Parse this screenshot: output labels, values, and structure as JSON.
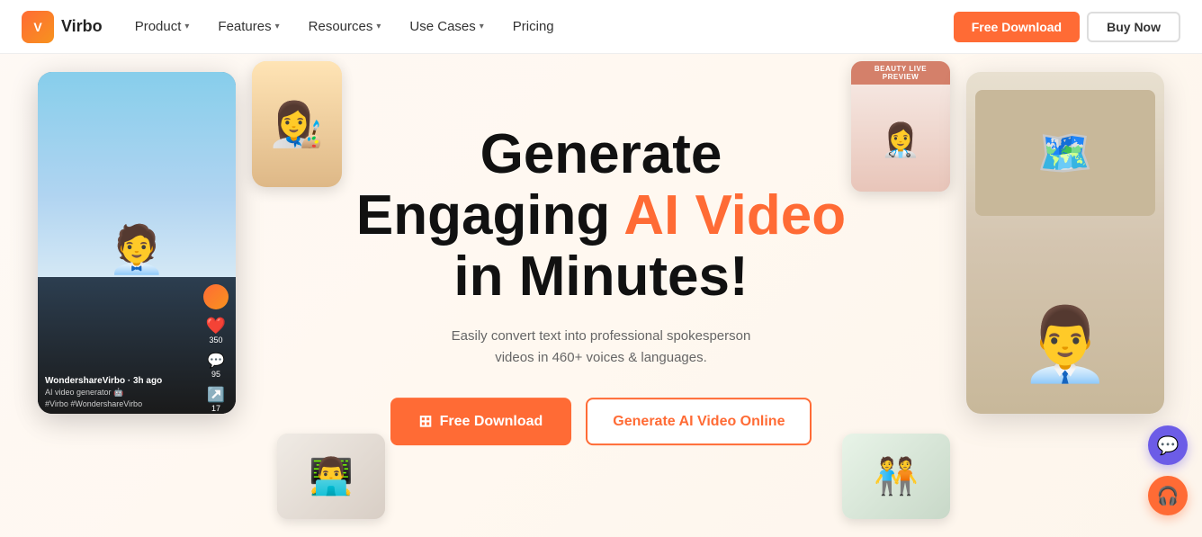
{
  "nav": {
    "logo_text": "Virbo",
    "items": [
      {
        "label": "Product",
        "has_dropdown": true
      },
      {
        "label": "Features",
        "has_dropdown": true
      },
      {
        "label": "Resources",
        "has_dropdown": true
      },
      {
        "label": "Use Cases",
        "has_dropdown": true
      },
      {
        "label": "Pricing",
        "has_dropdown": false
      }
    ],
    "btn_download": "Free Download",
    "btn_buy": "Buy Now"
  },
  "hero": {
    "title_line1": "Generate",
    "title_line2_prefix": "Engaging ",
    "title_line2_highlight": "AI Video",
    "title_line3": "in Minutes!",
    "subtitle_line1": "Easily convert text into professional spokesperson",
    "subtitle_line2": "videos in 460+ voices & languages.",
    "btn_download": "Free Download",
    "btn_online": "Generate AI Video Online"
  },
  "beauty_card": {
    "header_line1": "BEAUTY LIVE",
    "header_line2": "PREVIEW"
  },
  "tiktok": {
    "username": "WondershareVirbo · 3h ago",
    "desc": "AI video generator 🤖",
    "tag": "#Virbo #WondershareVirbo",
    "likes": "350",
    "comments": "95",
    "shares": "17"
  },
  "icons": {
    "windows": "⊞",
    "chat": "💬",
    "support": "🎧"
  }
}
